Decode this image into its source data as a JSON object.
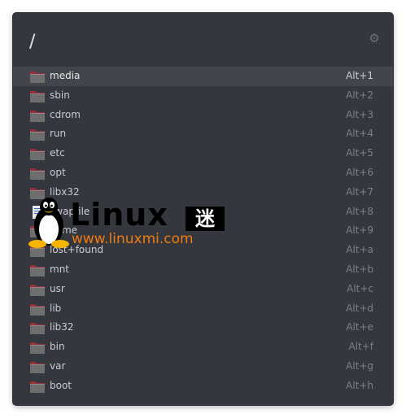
{
  "search": {
    "value": "/",
    "settings_icon": "gear-icon"
  },
  "results": [
    {
      "label": "media",
      "shortcut": "Alt+1",
      "icon": "folder-icon",
      "selected": true
    },
    {
      "label": "sbin",
      "shortcut": "Alt+2",
      "icon": "folder-icon"
    },
    {
      "label": "cdrom",
      "shortcut": "Alt+3",
      "icon": "folder-icon"
    },
    {
      "label": "run",
      "shortcut": "Alt+4",
      "icon": "folder-icon"
    },
    {
      "label": "etc",
      "shortcut": "Alt+5",
      "icon": "folder-icon"
    },
    {
      "label": "opt",
      "shortcut": "Alt+6",
      "icon": "folder-icon"
    },
    {
      "label": "libx32",
      "shortcut": "Alt+7",
      "icon": "folder-icon"
    },
    {
      "label": "swapfile",
      "shortcut": "Alt+8",
      "icon": "file-icon"
    },
    {
      "label": "home",
      "shortcut": "Alt+9",
      "icon": "folder-icon"
    },
    {
      "label": "lost+found",
      "shortcut": "Alt+a",
      "icon": "folder-icon"
    },
    {
      "label": "mnt",
      "shortcut": "Alt+b",
      "icon": "folder-icon"
    },
    {
      "label": "usr",
      "shortcut": "Alt+c",
      "icon": "folder-icon"
    },
    {
      "label": "lib",
      "shortcut": "Alt+d",
      "icon": "folder-icon"
    },
    {
      "label": "lib32",
      "shortcut": "Alt+e",
      "icon": "folder-icon"
    },
    {
      "label": "bin",
      "shortcut": "Alt+f",
      "icon": "folder-icon"
    },
    {
      "label": "var",
      "shortcut": "Alt+g",
      "icon": "folder-icon"
    },
    {
      "label": "boot",
      "shortcut": "Alt+h",
      "icon": "folder-icon"
    }
  ],
  "watermark": {
    "brand": "Linux",
    "brand_cn": "迷",
    "url": "www.linuxmi.com",
    "mascot_icon": "tux-penguin-icon"
  },
  "colors": {
    "panel_bg": "#34373d",
    "selected_row_bg": "#42454b",
    "folder_body": "#6e6e6e",
    "folder_tab": "#9b2f3c",
    "watermark_url": "#f07b0e"
  }
}
